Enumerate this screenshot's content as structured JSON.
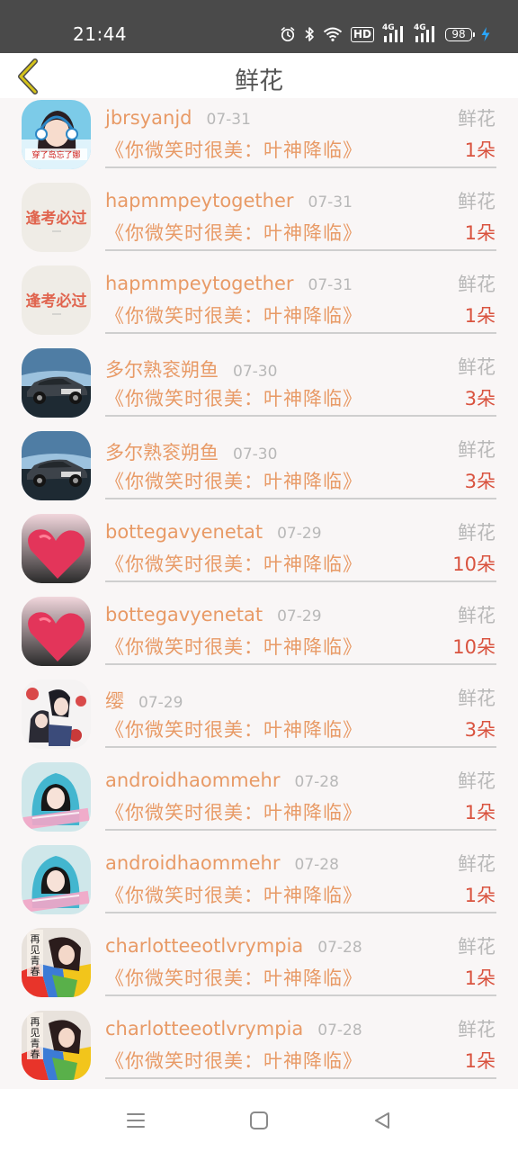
{
  "status_bar": {
    "time": "21:44",
    "hd_label": "HD",
    "network_1": "4G",
    "network_2": "4G",
    "battery": "98"
  },
  "header": {
    "title": "鲜花",
    "back_icon": "chevron-left-icon"
  },
  "colors": {
    "name": "#e89a66",
    "count": "#d9533f",
    "muted": "#b8b8b8",
    "back_icon": "#c9b400"
  },
  "rows": [
    {
      "avatar": "girl-headphones-avatar",
      "name": "jbrsyanjd",
      "date": "07-31",
      "type": "鲜花",
      "book": "《你微笑时很美：叶神降临》",
      "count": "1朵"
    },
    {
      "avatar": "calligraphy-avatar",
      "name": "hapmmpeytogether",
      "date": "07-31",
      "type": "鲜花",
      "book": "《你微笑时很美：叶神降临》",
      "count": "1朵"
    },
    {
      "avatar": "calligraphy-avatar",
      "name": "hapmmpeytogether",
      "date": "07-31",
      "type": "鲜花",
      "book": "《你微笑时很美：叶神降临》",
      "count": "1朵"
    },
    {
      "avatar": "car-avatar",
      "name": "多尔熟衮朔鱼",
      "date": "07-30",
      "type": "鲜花",
      "book": "《你微笑时很美：叶神降临》",
      "count": "3朵"
    },
    {
      "avatar": "car-avatar",
      "name": "多尔熟衮朔鱼",
      "date": "07-30",
      "type": "鲜花",
      "book": "《你微笑时很美：叶神降临》",
      "count": "3朵"
    },
    {
      "avatar": "pink-heart-avatar",
      "name": "bottegavyenetat",
      "date": "07-29",
      "type": "鲜花",
      "book": "《你微笑时很美：叶神降临》",
      "count": "10朵"
    },
    {
      "avatar": "pink-heart-avatar",
      "name": "bottegavyenetat",
      "date": "07-29",
      "type": "鲜花",
      "book": "《你微笑时很美：叶神降临》",
      "count": "10朵"
    },
    {
      "avatar": "anime-couple-avatar",
      "name": "缨",
      "date": "07-29",
      "type": "鲜花",
      "book": "《你微笑时很美：叶神降临》",
      "count": "3朵"
    },
    {
      "avatar": "girl-hood-avatar",
      "name": "androidhaommehr",
      "date": "07-28",
      "type": "鲜花",
      "book": "《你微笑时很美：叶神降临》",
      "count": "1朵"
    },
    {
      "avatar": "girl-hood-avatar",
      "name": "androidhaommehr",
      "date": "07-28",
      "type": "鲜花",
      "book": "《你微笑时很美：叶神降临》",
      "count": "1朵"
    },
    {
      "avatar": "colorful-girl-avatar",
      "name": "charlotteeotlvrympia",
      "date": "07-28",
      "type": "鲜花",
      "book": "《你微笑时很美：叶神降临》",
      "count": "1朵"
    },
    {
      "avatar": "colorful-girl-avatar",
      "name": "charlotteeotlvrympia",
      "date": "07-28",
      "type": "鲜花",
      "book": "《你微笑时很美：叶神降临》",
      "count": "1朵"
    }
  ],
  "avatar_art": {
    "girl-headphones-avatar": {
      "caption": "穿了岛忘了娜"
    },
    "calligraphy-avatar": {
      "caption": "逢考必过"
    },
    "colorful-girl-avatar": {
      "caption": "再见青春"
    }
  },
  "nav_bar": {
    "menu_icon": "menu-icon",
    "home_icon": "home-icon",
    "back_icon": "back-triangle-icon"
  }
}
